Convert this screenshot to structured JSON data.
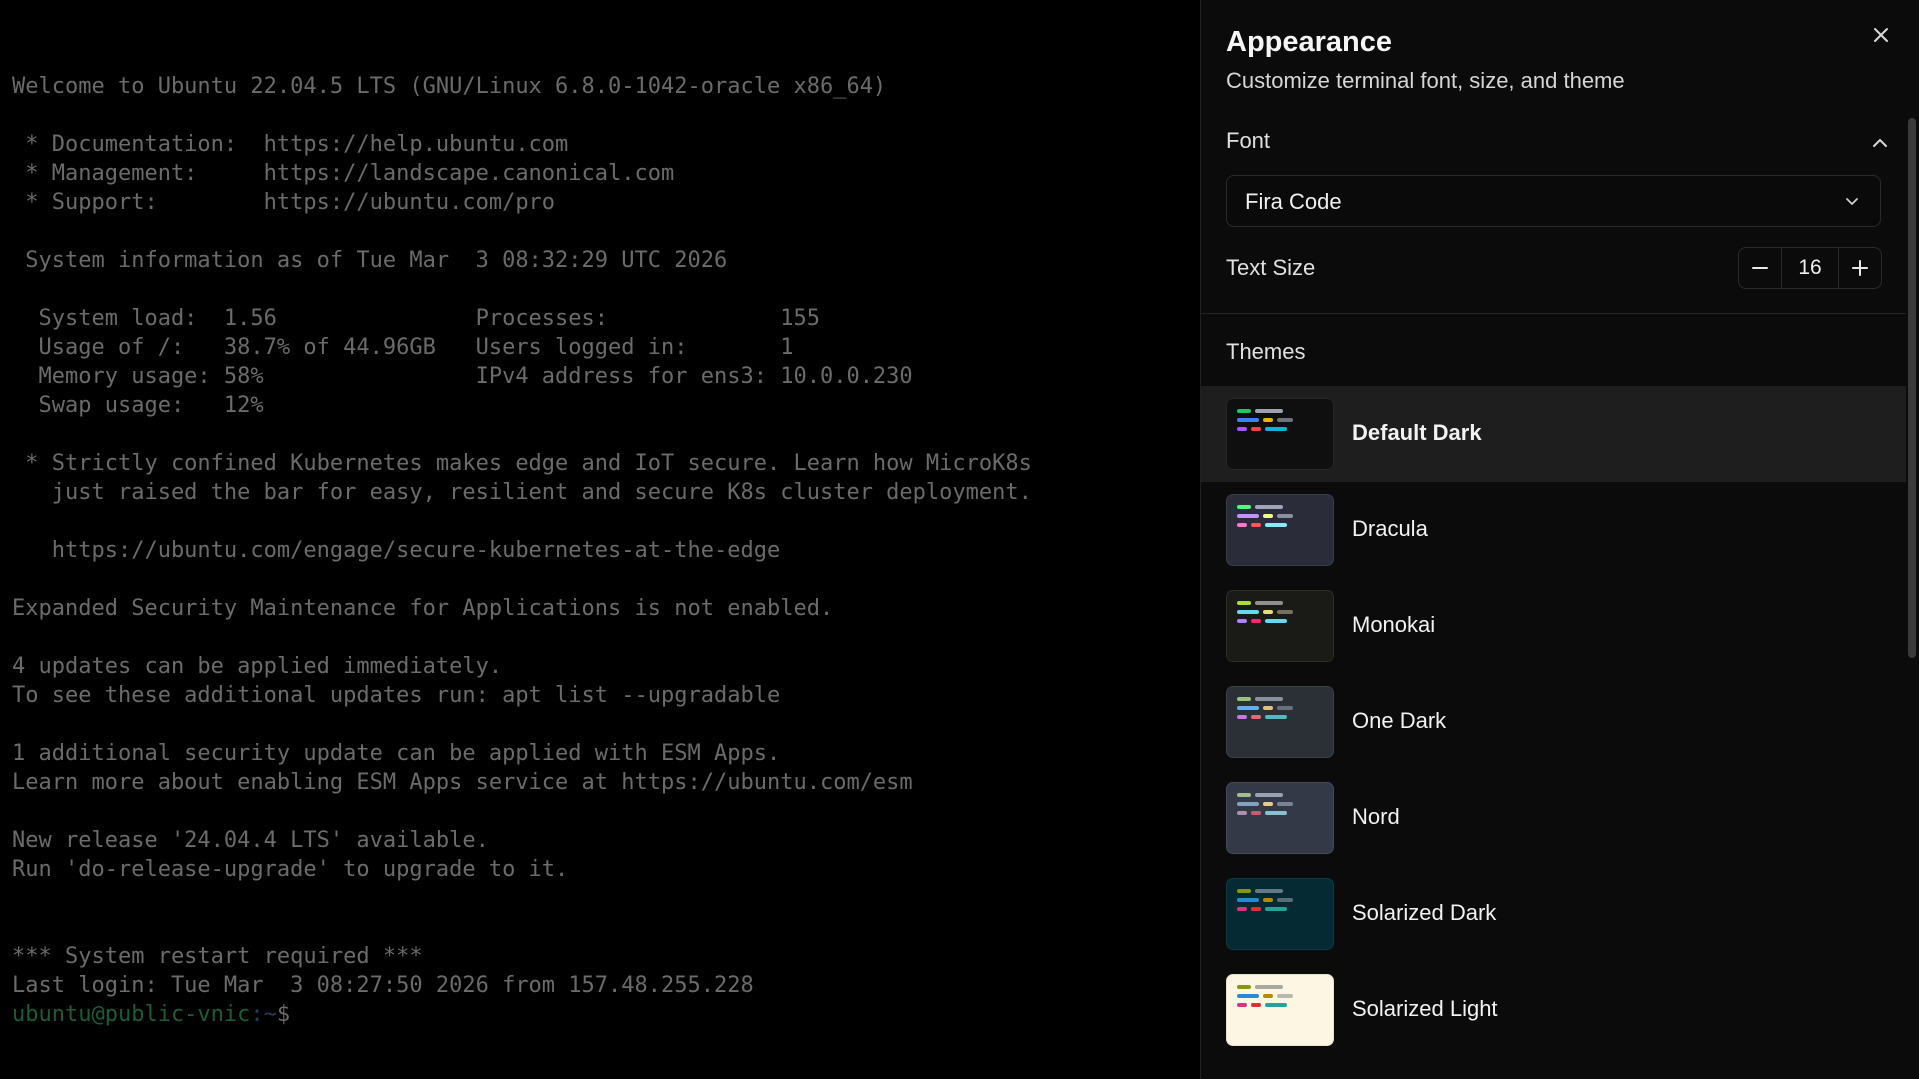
{
  "terminal": {
    "lines": "Welcome to Ubuntu 22.04.5 LTS (GNU/Linux 6.8.0-1042-oracle x86_64)\n\n * Documentation:  https://help.ubuntu.com\n * Management:     https://landscape.canonical.com\n * Support:        https://ubuntu.com/pro\n\n System information as of Tue Mar  3 08:32:29 UTC 2026\n\n  System load:  1.56               Processes:             155\n  Usage of /:   38.7% of 44.96GB   Users logged in:       1\n  Memory usage: 58%                IPv4 address for ens3: 10.0.0.230\n  Swap usage:   12%\n\n * Strictly confined Kubernetes makes edge and IoT secure. Learn how MicroK8s\n   just raised the bar for easy, resilient and secure K8s cluster deployment.\n\n   https://ubuntu.com/engage/secure-kubernetes-at-the-edge\n\nExpanded Security Maintenance for Applications is not enabled.\n\n4 updates can be applied immediately.\nTo see these additional updates run: apt list --upgradable\n\n1 additional security update can be applied with ESM Apps.\nLearn more about enabling ESM Apps service at https://ubuntu.com/esm\n\nNew release '24.04.4 LTS' available.\nRun 'do-release-upgrade' to upgrade to it.\n\n\n*** System restart required ***\nLast login: Tue Mar  3 08:27:50 2026 from 157.48.255.228",
    "prompt_user": "ubuntu@public-vnic",
    "prompt_path": ":~",
    "prompt_symbol": "$"
  },
  "panel": {
    "title": "Appearance",
    "subtitle": "Customize terminal font, size, and theme",
    "font_section_label": "Font",
    "font_selected": "Fira Code",
    "text_size_label": "Text Size",
    "text_size_value": "16",
    "themes_label": "Themes",
    "themes": [
      {
        "name": "Default Dark",
        "active": true,
        "bg": "#0f0f10",
        "border": "#262626",
        "bars": [
          "#22c55e",
          "#9ca3af",
          "#3b82f6",
          "#eab308",
          "#6b7280",
          "#a855f7",
          "#ef4444",
          "#06b6d4"
        ]
      },
      {
        "name": "Dracula",
        "active": false,
        "bg": "#2a2c3a",
        "border": "#3a3c4a",
        "bars": [
          "#50fa7b",
          "#a0a4b8",
          "#bd93f9",
          "#f1fa8c",
          "#8b8fa3",
          "#ff79c6",
          "#ff5555",
          "#8be9fd"
        ]
      },
      {
        "name": "Monokai",
        "active": false,
        "bg": "#1a1a17",
        "border": "#2e2e2a",
        "bars": [
          "#a6e22e",
          "#8f8f8f",
          "#66d9ef",
          "#e6db74",
          "#75715e",
          "#ae81ff",
          "#f92672",
          "#66d9ef"
        ]
      },
      {
        "name": "One Dark",
        "active": false,
        "bg": "#2b2f36",
        "border": "#3a3f47",
        "bars": [
          "#98c379",
          "#8b919c",
          "#61afef",
          "#e5c07b",
          "#6b717c",
          "#c678dd",
          "#e06c75",
          "#56b6c2"
        ]
      },
      {
        "name": "Nord",
        "active": false,
        "bg": "#333946",
        "border": "#434b5a",
        "bars": [
          "#a3be8c",
          "#9aa3b2",
          "#81a1c1",
          "#ebcb8b",
          "#7a8394",
          "#b48ead",
          "#bf616a",
          "#88c0d0"
        ]
      },
      {
        "name": "Solarized Dark",
        "active": false,
        "bg": "#062a33",
        "border": "#0e3a45",
        "bars": [
          "#859900",
          "#657b83",
          "#268bd2",
          "#b58900",
          "#586e75",
          "#d33682",
          "#dc322f",
          "#2aa198"
        ]
      },
      {
        "name": "Solarized Light",
        "active": false,
        "bg": "#fdf6e3",
        "border": "#e8e1cc",
        "bars": [
          "#859900",
          "#a9a9a0",
          "#268bd2",
          "#b58900",
          "#b8b8ae",
          "#d33682",
          "#dc322f",
          "#2aa198"
        ]
      }
    ]
  }
}
